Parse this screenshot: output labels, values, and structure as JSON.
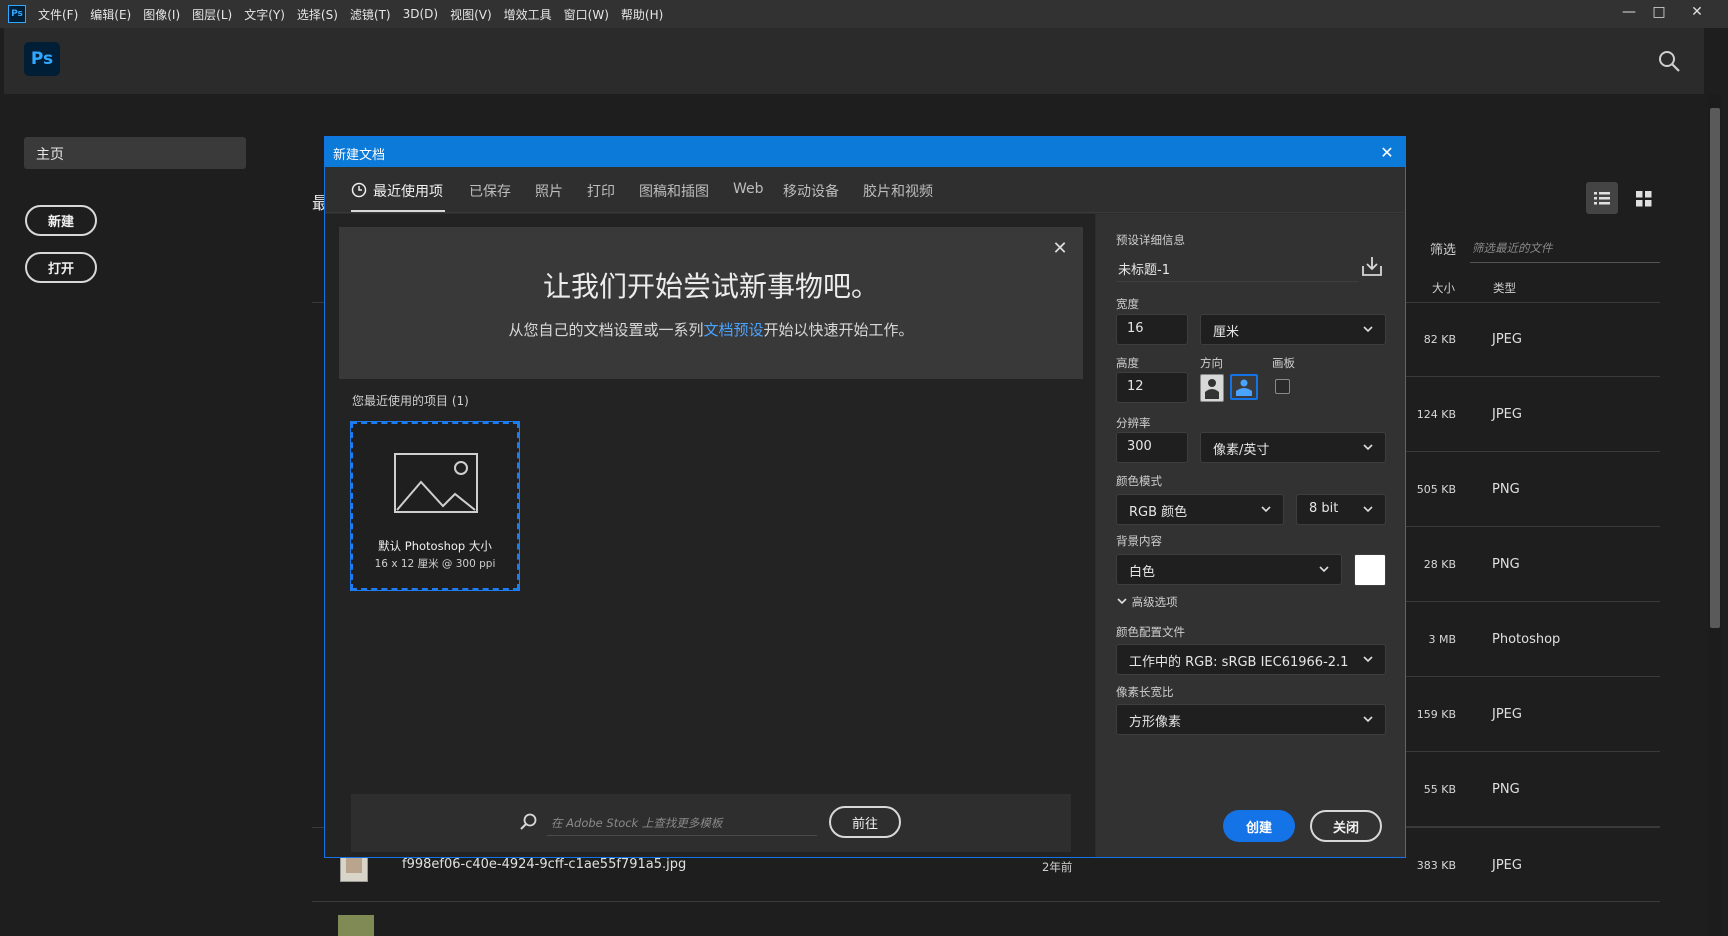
{
  "menubar": {
    "app_icon": "Ps",
    "items": [
      "文件(F)",
      "编辑(E)",
      "图像(I)",
      "图层(L)",
      "文字(Y)",
      "选择(S)",
      "滤镜(T)",
      "3D(D)",
      "视图(V)",
      "增效工具",
      "窗口(W)",
      "帮助(H)"
    ],
    "window_controls": [
      "—",
      "□",
      "✕"
    ]
  },
  "header": {
    "logo": "Ps"
  },
  "sidebar": {
    "home": "主页",
    "new_button": "新建",
    "open_button": "打开",
    "recent_partial": "最"
  },
  "home_list": {
    "filter_label": "筛选",
    "filter_placeholder": "筛选最近的文件",
    "columns": {
      "size": "大小",
      "type": "类型"
    },
    "rows": [
      {
        "size": "82 KB",
        "type": "JPEG"
      },
      {
        "size": "124 KB",
        "type": "JPEG"
      },
      {
        "size": "505 KB",
        "type": "PNG"
      },
      {
        "size": "28 KB",
        "type": "PNG"
      },
      {
        "size": "3 MB",
        "type": "Photoshop"
      },
      {
        "size": "159 KB",
        "type": "JPEG"
      },
      {
        "size": "55 KB",
        "type": "PNG"
      },
      {
        "name": "f998ef06-c40e-4924-9cff-c1ae55f791a5.jpg",
        "modified": "2年前",
        "size": "383 KB",
        "type": "JPEG"
      }
    ]
  },
  "dialog": {
    "title": "新建文档",
    "tabs": [
      "最近使用项",
      "已保存",
      "照片",
      "打印",
      "图稿和插图",
      "Web",
      "移动设备",
      "胶片和视频"
    ],
    "active_tab": "最近使用项",
    "banner": {
      "title": "让我们开始尝试新事物吧。",
      "subtitle_before": "从您自己的文档设置或一系列",
      "subtitle_link": "文档预设",
      "subtitle_after": "开始以快速开始工作。"
    },
    "recent_label": "您最近使用的项目 (1)",
    "preset": {
      "name": "默认 Photoshop 大小",
      "size": "16 x 12 厘米 @ 300 ppi"
    },
    "stock": {
      "placeholder": "在 Adobe Stock 上查找更多模板",
      "go_button": "前往"
    },
    "details": {
      "section_label": "预设详细信息",
      "doc_name": "未标题-1",
      "width_label": "宽度",
      "width_value": "16",
      "width_unit": "厘米",
      "height_label": "高度",
      "height_value": "12",
      "orientation_label": "方向",
      "artboard_label": "画板",
      "resolution_label": "分辨率",
      "resolution_value": "300",
      "resolution_unit": "像素/英寸",
      "color_mode_label": "颜色模式",
      "color_mode": "RGB 颜色",
      "bit_depth": "8 bit",
      "background_label": "背景内容",
      "background": "白色",
      "background_swatch": "#ffffff",
      "advanced_label": "高级选项",
      "color_profile_label": "颜色配置文件",
      "color_profile": "工作中的 RGB: sRGB IEC61966-2.1",
      "pixel_aspect_label": "像素长宽比",
      "pixel_aspect": "方形像素",
      "create_button": "创建",
      "close_button": "关闭"
    }
  },
  "colors": {
    "accent": "#1473e6",
    "title_bar": "#0b7ad8",
    "link": "#4aa3ff"
  }
}
